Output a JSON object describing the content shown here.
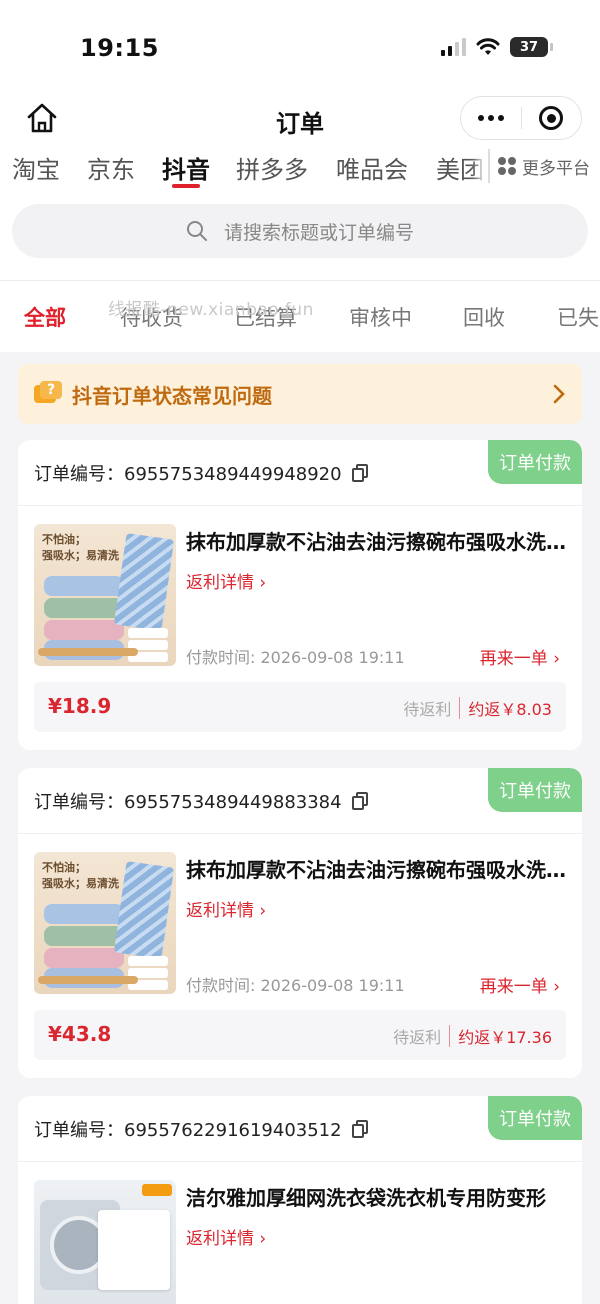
{
  "status_bar": {
    "time": "19:15",
    "battery": "37"
  },
  "nav": {
    "title": "订单"
  },
  "platform_tabs": [
    {
      "label": "淘宝",
      "active": false
    },
    {
      "label": "京东",
      "active": false
    },
    {
      "label": "抖音",
      "active": true
    },
    {
      "label": "拼多多",
      "active": false
    },
    {
      "label": "唯品会",
      "active": false
    },
    {
      "label": "美团",
      "active": false
    }
  ],
  "more_platforms": "更多平台",
  "search": {
    "placeholder": "请搜索标题或订单编号"
  },
  "status_tabs": [
    {
      "label": "全部",
      "active": true
    },
    {
      "label": "待收货",
      "active": false
    },
    {
      "label": "已结算",
      "active": false
    },
    {
      "label": "审核中",
      "active": false
    },
    {
      "label": "回收",
      "active": false
    },
    {
      "label": "已失",
      "active": false
    }
  ],
  "watermark": "线报酷-new.xianbao.fun",
  "faq": {
    "text": "抖音订单状态常见问题",
    "icon_text": "?"
  },
  "orders": [
    {
      "order_label": "订单编号：",
      "order_no": "6955753489449948920",
      "status": "订单付款",
      "title": "抹布加厚款不沾油去油污擦碗布强吸水洗碗巾",
      "rebate_link": "返利详情",
      "pay_time": "付款时间: 2026-09-08 19:11",
      "reorder": "再来一单",
      "price": "¥18.9",
      "rebate_status": "待返利",
      "rebate_amount": "约返￥8.03",
      "thumb": {
        "line1": "不怕油；",
        "line2": "强吸水；易清洗"
      }
    },
    {
      "order_label": "订单编号：",
      "order_no": "6955753489449883384",
      "status": "订单付款",
      "title": "抹布加厚款不沾油去油污擦碗布强吸水洗碗巾",
      "rebate_link": "返利详情",
      "pay_time": "付款时间: 2026-09-08 19:11",
      "reorder": "再来一单",
      "price": "¥43.8",
      "rebate_status": "待返利",
      "rebate_amount": "约返￥17.36",
      "thumb": {
        "line1": "不怕油；",
        "line2": "强吸水；易清洗"
      }
    },
    {
      "order_label": "订单编号：",
      "order_no": "6955762291619403512",
      "status": "订单付款",
      "title": "洁尔雅加厚细网洗衣袋洗衣机专用防变形",
      "rebate_link": "返利详情"
    }
  ],
  "colors": {
    "accent": "#e0212b",
    "status_green": "#7ed08a",
    "faq_bg": "#fdf1dc"
  }
}
